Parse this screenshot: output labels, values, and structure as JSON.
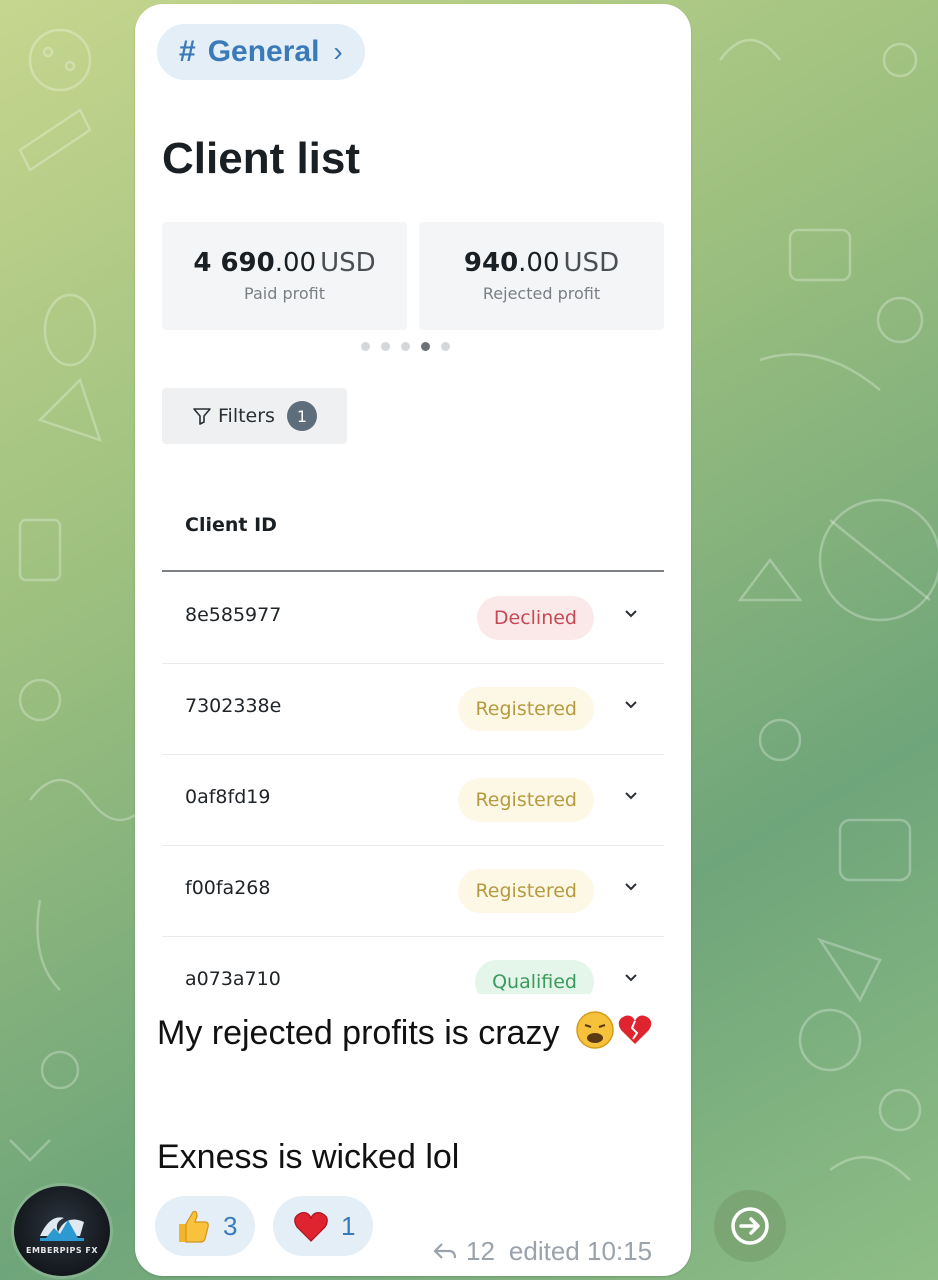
{
  "topic": {
    "icon": "hash-icon",
    "label": "General",
    "chevron": "›"
  },
  "screenshot": {
    "title": "Client list",
    "cards": [
      {
        "amount_major": "4 690",
        "amount_minor": ".00",
        "currency": "USD",
        "caption": "Paid profit"
      },
      {
        "amount_major": "940",
        "amount_minor": ".00",
        "currency": "USD",
        "caption": "Rejected profit"
      }
    ],
    "carousel": {
      "count": 5,
      "active_index": 3
    },
    "filters": {
      "label": "Filters",
      "badge": "1"
    },
    "table": {
      "column_header": "Client ID",
      "rows": [
        {
          "client_id": "8e585977",
          "status": "Declined"
        },
        {
          "client_id": "7302338e",
          "status": "Registered"
        },
        {
          "client_id": "0af8fd19",
          "status": "Registered"
        },
        {
          "client_id": "f00fa268",
          "status": "Registered"
        },
        {
          "client_id": "a073a710",
          "status": "Qualified"
        }
      ]
    }
  },
  "message": {
    "line1": "My rejected profits is crazy",
    "line1_emojis": [
      "weary-face-emoji",
      "broken-heart-emoji"
    ],
    "line2": "Exness is wicked lol"
  },
  "reactions": [
    {
      "emoji": "thumbs-up-emoji",
      "count": "3"
    },
    {
      "emoji": "red-heart-emoji",
      "count": "1"
    }
  ],
  "meta": {
    "reply_count": "12",
    "edited_time": "edited 10:15"
  },
  "avatar": {
    "brand": "EMBERPIPS FX"
  },
  "colors": {
    "bubble": "#ffffff",
    "accent": "#3a7ab8",
    "declined": "#c44a55",
    "registered": "#b59a3f",
    "qualified": "#3b9a5e"
  }
}
